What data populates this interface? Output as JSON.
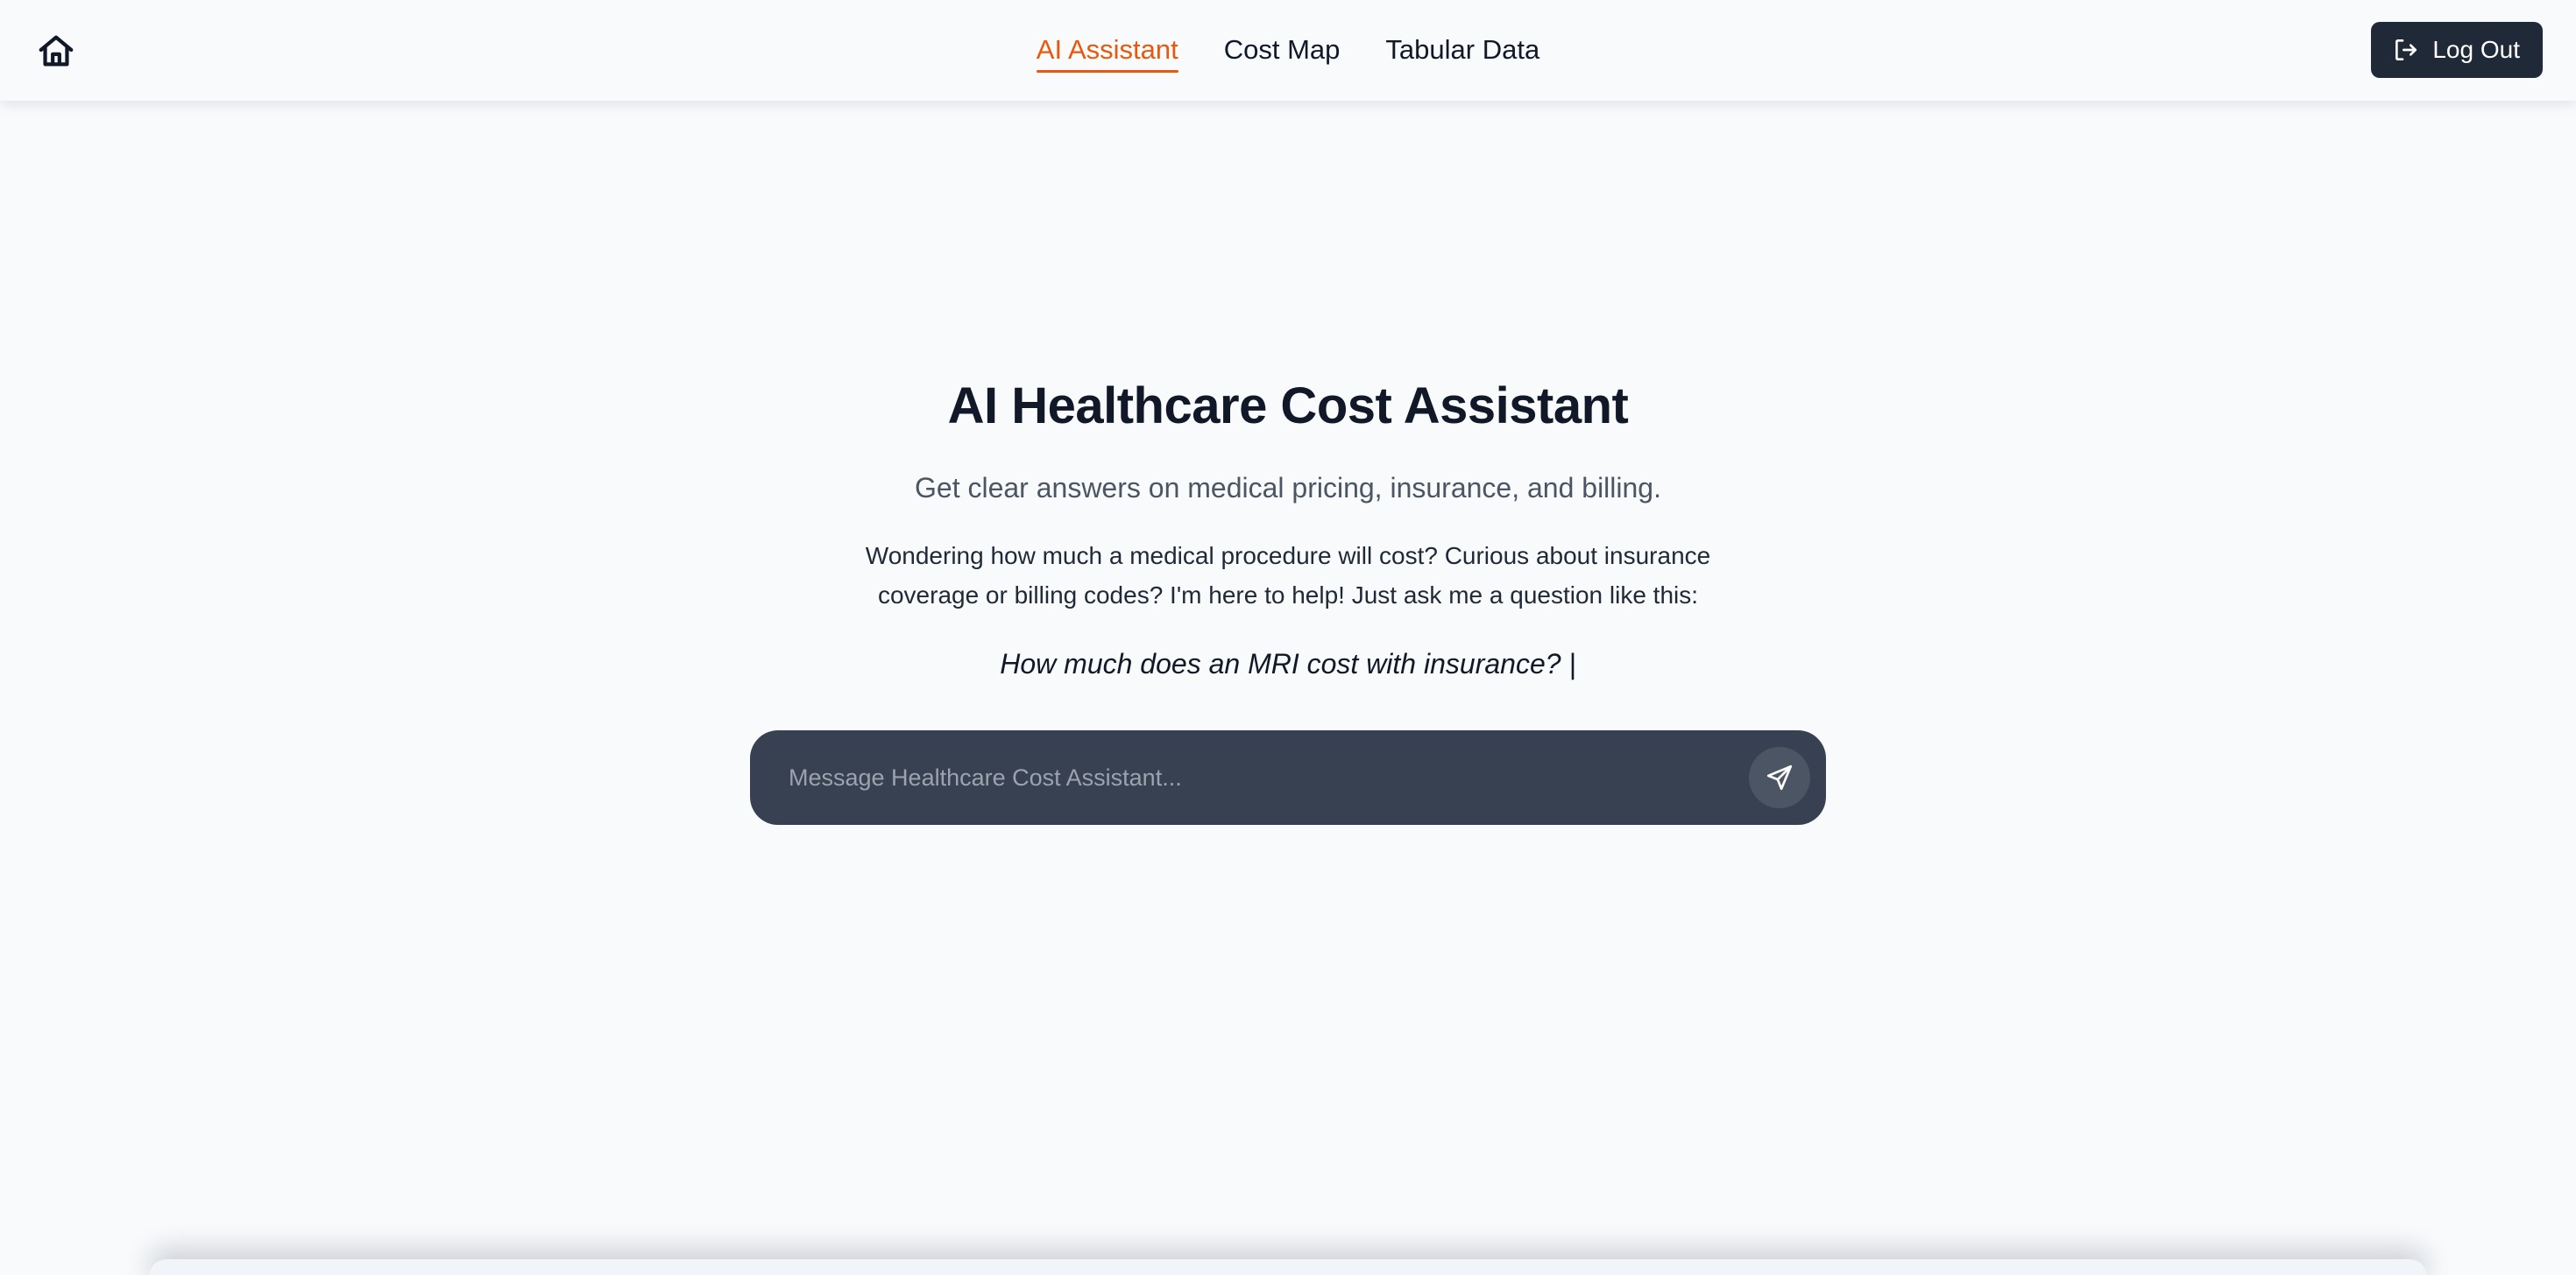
{
  "nav": {
    "home_icon": "home-icon",
    "links": [
      {
        "label": "AI Assistant",
        "active": true
      },
      {
        "label": "Cost Map",
        "active": false
      },
      {
        "label": "Tabular Data",
        "active": false
      }
    ],
    "logout_label": "Log Out",
    "logout_icon": "logout-icon"
  },
  "hero": {
    "title": "AI Healthcare Cost Assistant",
    "subtitle": "Get clear answers on medical pricing, insurance, and billing.",
    "body": "Wondering how much a medical procedure will cost? Curious about insurance coverage or billing codes? I'm here to help! Just ask me a question like this:",
    "example": "How much does an MRI cost with insurance? |"
  },
  "chat": {
    "placeholder": "Message Healthcare Cost Assistant...",
    "value": "",
    "send_icon": "send-icon"
  },
  "colors": {
    "accent": "#ea580c",
    "background": "#f8fafc",
    "chat_bar": "#374151",
    "logout_button": "#1f2937"
  }
}
